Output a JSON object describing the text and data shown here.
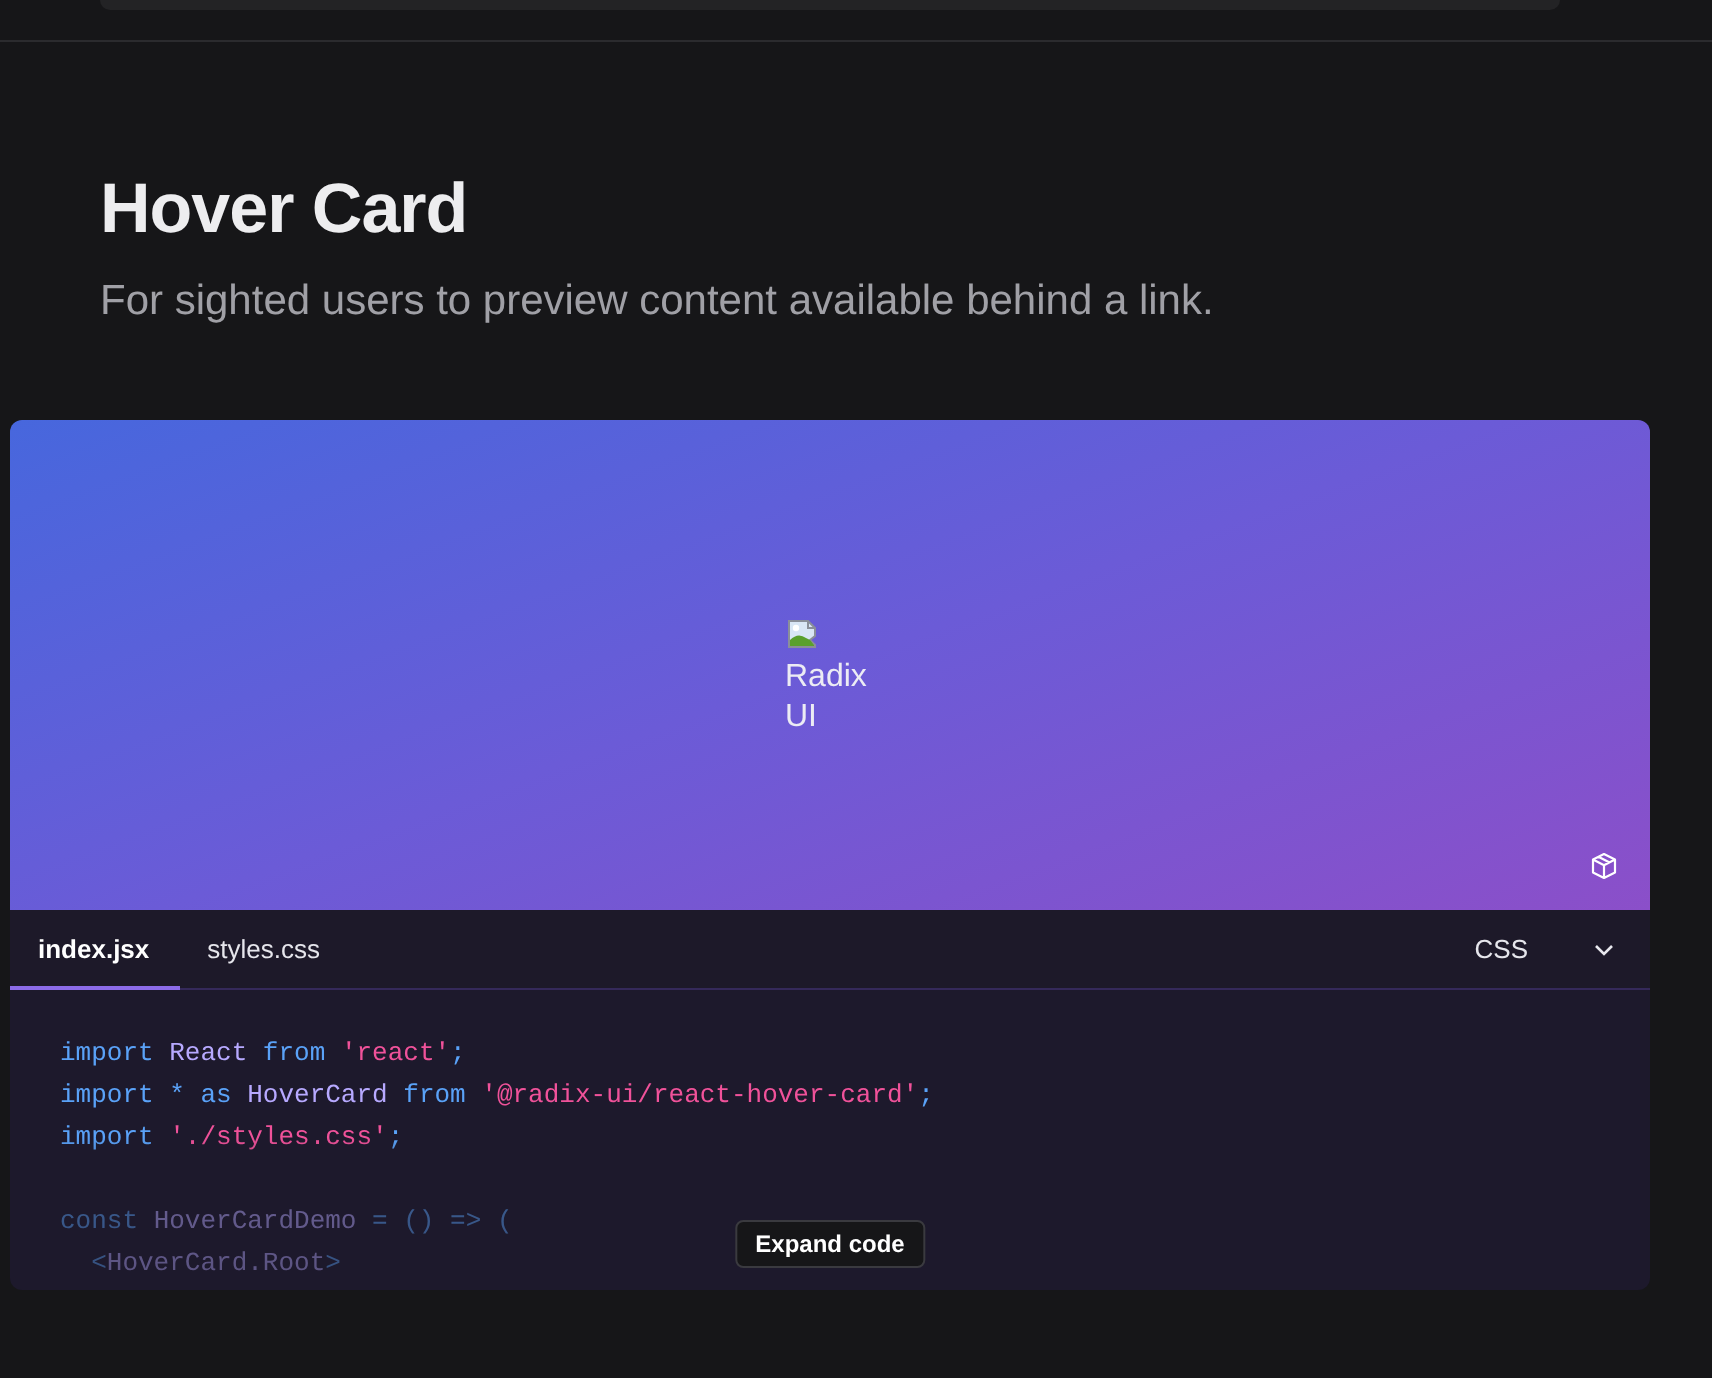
{
  "page": {
    "title": "Hover Card",
    "description": "For sighted users to preview content available behind a link."
  },
  "demo": {
    "image_alt": "Radix UI"
  },
  "code_panel": {
    "tabs": [
      {
        "label": "index.jsx",
        "selected": true
      },
      {
        "label": "styles.css",
        "selected": false
      }
    ],
    "language": "CSS",
    "expanded": false,
    "lines": [
      {
        "kind": "code",
        "tokens": [
          {
            "kind": "keyword",
            "text": "import "
          },
          {
            "kind": "identifier",
            "text": "React "
          },
          {
            "kind": "keyword",
            "text": "from "
          },
          {
            "kind": "string",
            "text": "'react'"
          },
          {
            "kind": "punctuation",
            "text": ";"
          }
        ]
      },
      {
        "kind": "code",
        "tokens": [
          {
            "kind": "keyword",
            "text": "import "
          },
          {
            "kind": "punctuation",
            "text": "* "
          },
          {
            "kind": "keyword",
            "text": "as "
          },
          {
            "kind": "identifier",
            "text": "HoverCard "
          },
          {
            "kind": "keyword",
            "text": "from "
          },
          {
            "kind": "string",
            "text": "'@radix-ui/react-hover-card'"
          },
          {
            "kind": "punctuation",
            "text": ";"
          }
        ]
      },
      {
        "kind": "code",
        "tokens": [
          {
            "kind": "keyword",
            "text": "import "
          },
          {
            "kind": "string",
            "text": "'./styles.css'"
          },
          {
            "kind": "punctuation",
            "text": ";"
          }
        ]
      },
      {
        "kind": "blank"
      },
      {
        "kind": "code",
        "tokens": [
          {
            "kind": "keyword",
            "text": "const "
          },
          {
            "kind": "identifier",
            "text": "HoverCardDemo "
          },
          {
            "kind": "punctuation",
            "text": "= () => ("
          }
        ]
      },
      {
        "kind": "code",
        "tokens": [
          {
            "kind": "punctuation",
            "text": "  <"
          },
          {
            "kind": "identifier",
            "text": "HoverCard.Root"
          },
          {
            "kind": "punctuation",
            "text": ">"
          }
        ]
      }
    ],
    "expand_button": "Expand code"
  }
}
